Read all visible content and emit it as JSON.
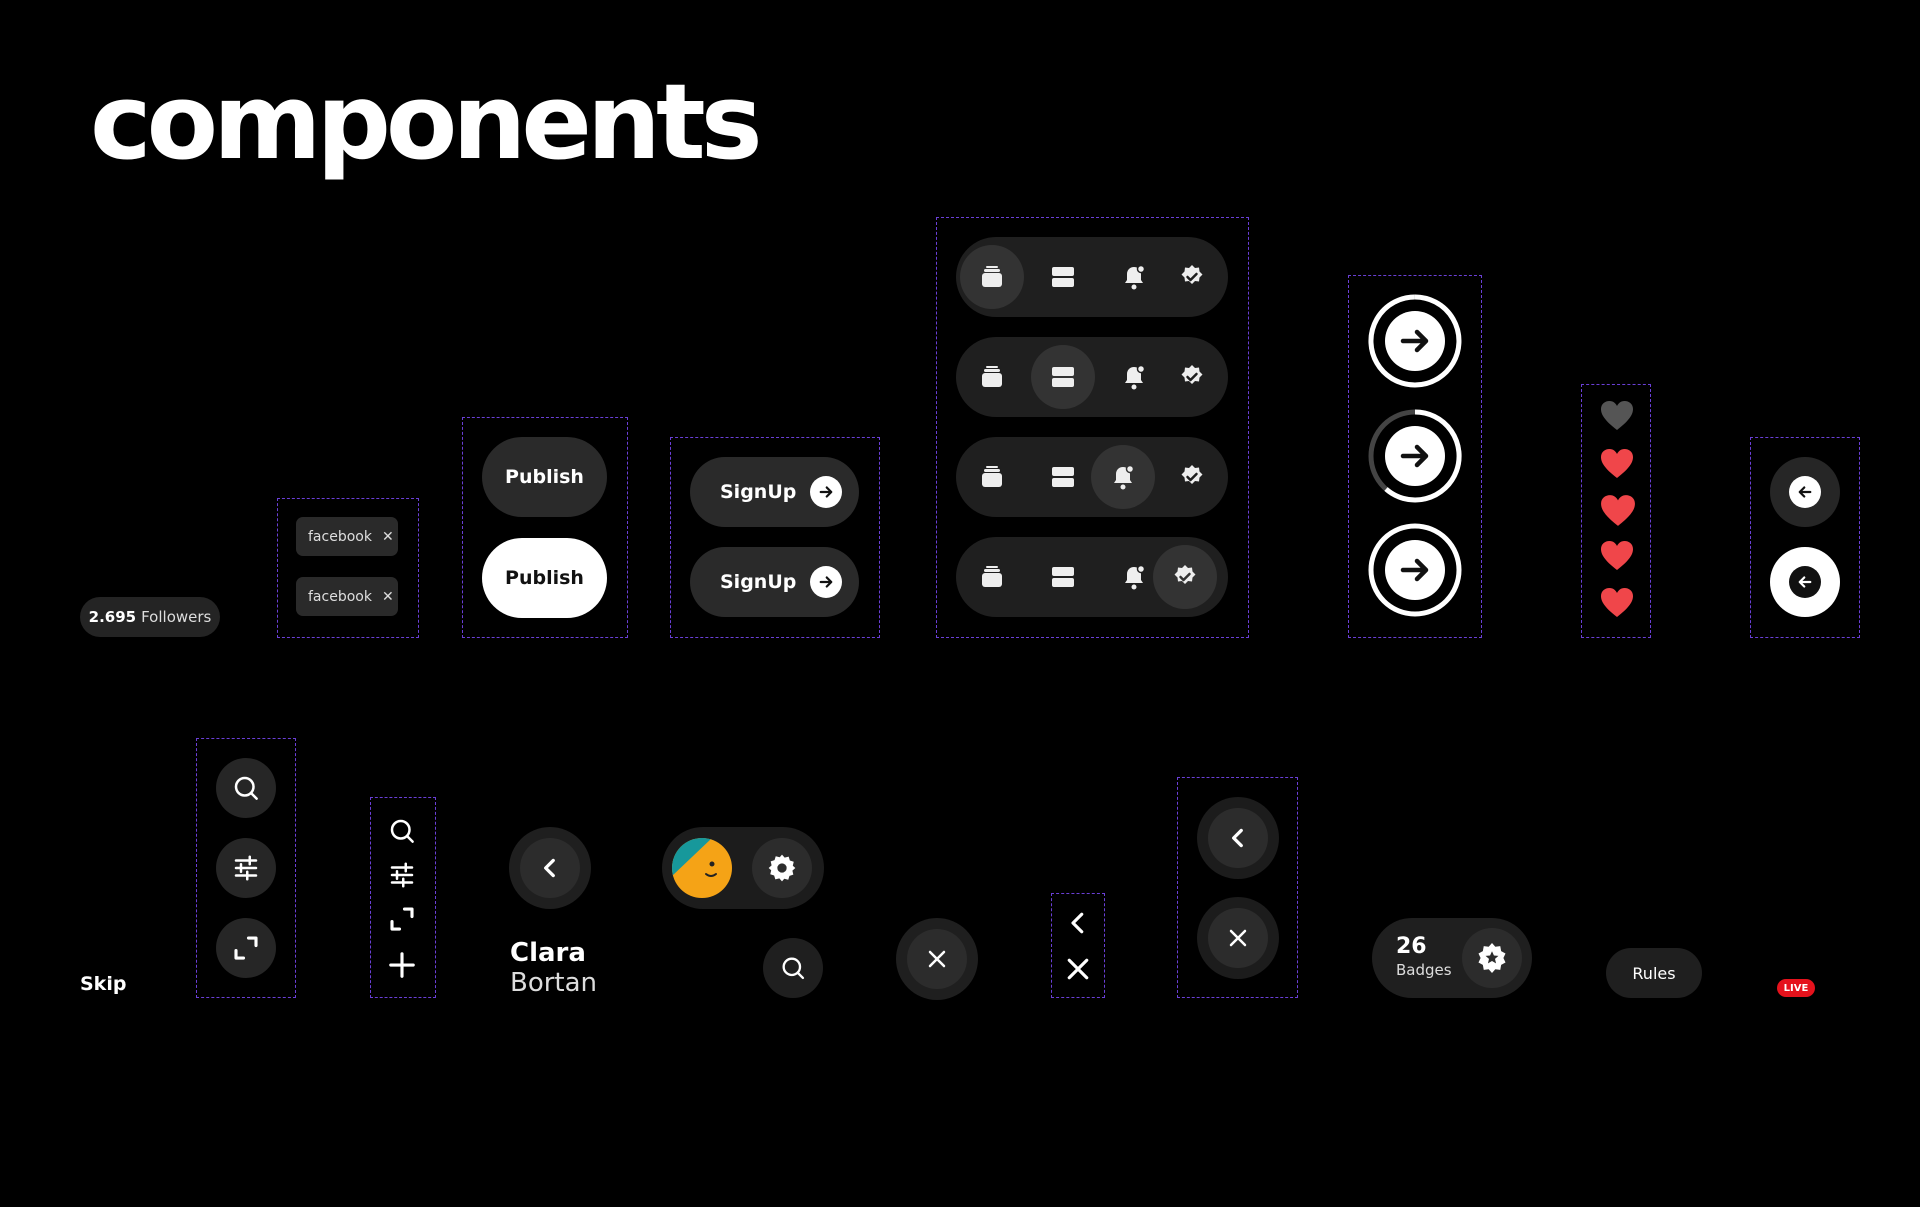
{
  "page": {
    "title": "components"
  },
  "followers": {
    "count": "2.695",
    "label": "Followers"
  },
  "tags": [
    {
      "label": "facebook"
    },
    {
      "label": "facebook"
    }
  ],
  "publish": {
    "dark_label": "Publish",
    "light_label": "Publish"
  },
  "signup": {
    "labels": [
      "SignUp",
      "SignUp"
    ]
  },
  "skip": {
    "label": "Skip"
  },
  "user": {
    "first_name": "Clara",
    "last_name": "Bortan"
  },
  "badges": {
    "count": "26",
    "label": "Badges"
  },
  "rules": {
    "label": "Rules"
  },
  "live": {
    "label": "LIVE"
  },
  "icons": {
    "nav": [
      "inbox-icon",
      "list-icon",
      "bell-icon",
      "verified-icon"
    ],
    "progress": "arrow-right-icon",
    "hearts": [
      "heart-icon"
    ]
  },
  "colors": {
    "accent_dash": "#6a3fd6",
    "live": "#e5121c",
    "heart": "#f0464a",
    "avatar_bg": "#f5a316",
    "avatar_teal": "#17989b"
  }
}
